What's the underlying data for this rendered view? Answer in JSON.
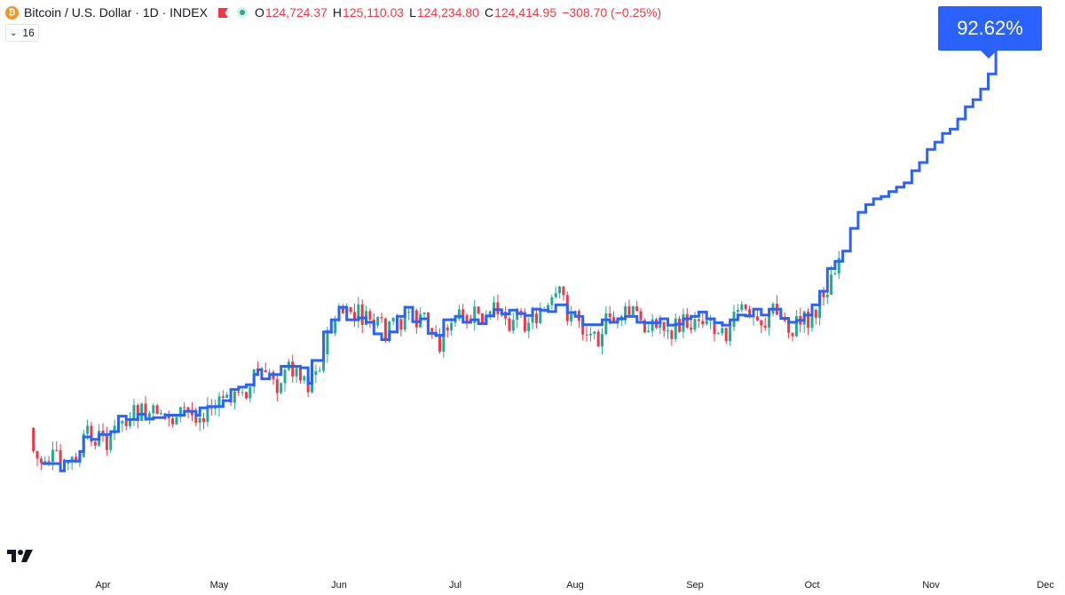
{
  "header": {
    "coin_symbol": "₿",
    "title": "Bitcoin / U.S. Dollar · 1D · INDEX",
    "open_label": "O",
    "open": "124,724.37",
    "high_label": "H",
    "high": "125,110.03",
    "low_label": "L",
    "low": "124,234.80",
    "close_label": "C",
    "close": "124,414.95",
    "change": "−308.70 (−0.25%)"
  },
  "collapse": {
    "count": "16"
  },
  "badge": {
    "value": "92.62%"
  },
  "colors": {
    "up": "#22ab94",
    "down": "#f23645",
    "line": "#2962ff",
    "text": "#131722"
  },
  "chart_data": {
    "type": "line",
    "x_ticks": [
      "Apr",
      "May",
      "Jun",
      "Jul",
      "Aug",
      "Sep",
      "Oct",
      "Nov",
      "Dec"
    ],
    "grid": false,
    "series": [
      {
        "kind": "step-line",
        "points": [
          [
            "Mar 18",
            0
          ],
          [
            "Mar 21",
            -1.5
          ],
          [
            "Mar 22",
            0.5
          ],
          [
            "Mar 26",
            2.5
          ],
          [
            "Mar 27",
            5.5
          ],
          [
            "Mar 29",
            5
          ],
          [
            "Mar 31",
            6
          ],
          [
            "Apr 3",
            6.6
          ],
          [
            "Apr 5",
            9.8
          ],
          [
            "Apr 7",
            9.1
          ],
          [
            "Apr 10",
            10.2
          ],
          [
            "Apr 12",
            9.2
          ],
          [
            "Apr 14",
            9.5
          ],
          [
            "Apr 17",
            10
          ],
          [
            "Apr 20",
            10
          ],
          [
            "Apr 22",
            10.8
          ],
          [
            "Apr 25",
            10
          ],
          [
            "Apr 26",
            11.5
          ],
          [
            "Apr 28",
            11.8
          ],
          [
            "May 2",
            13
          ],
          [
            "May 4",
            15.3
          ],
          [
            "May 6",
            15.8
          ],
          [
            "May 8",
            16.3
          ],
          [
            "May 10",
            18.4
          ],
          [
            "May 11",
            19.4
          ],
          [
            "May 12",
            17.5
          ],
          [
            "May 14",
            18.4
          ],
          [
            "May 17",
            20.1
          ],
          [
            "May 19",
            20.1
          ],
          [
            "May 22",
            19.8
          ],
          [
            "May 24",
            16.6
          ],
          [
            "May 25",
            21.3
          ],
          [
            "May 28",
            27.2
          ],
          [
            "May 30",
            29.7
          ],
          [
            "Jun 1",
            32.3
          ],
          [
            "Jun 3",
            29.7
          ],
          [
            "Jun 6",
            30.1
          ],
          [
            "Jun 8",
            29.2
          ],
          [
            "Jun 10",
            26.8
          ],
          [
            "Jun 12",
            25.6
          ],
          [
            "Jun 14",
            27.2
          ],
          [
            "Jun 16",
            30.4
          ],
          [
            "Jun 18",
            32.3
          ],
          [
            "Jun 20",
            29.3
          ],
          [
            "Jun 22",
            29.9
          ],
          [
            "Jun 24",
            26.9
          ],
          [
            "Jun 26",
            26.5
          ],
          [
            "Jun 28",
            29.7
          ],
          [
            "Jul 1",
            30.4
          ],
          [
            "Jul 3",
            29.2
          ],
          [
            "Jul 5",
            29.7
          ],
          [
            "Jul 7",
            28.9
          ],
          [
            "Jul 9",
            30.5
          ],
          [
            "Jul 11",
            31.8
          ],
          [
            "Jul 13",
            30.9
          ],
          [
            "Jul 15",
            31.7
          ],
          [
            "Jul 17",
            31
          ],
          [
            "Jul 19",
            30.6
          ],
          [
            "Jul 21",
            31.9
          ],
          [
            "Jul 23",
            31.7
          ],
          [
            "Jul 25",
            31.4
          ],
          [
            "Jul 27",
            32.8
          ],
          [
            "Jul 30",
            31.2
          ],
          [
            "Aug 1",
            30.4
          ],
          [
            "Aug 3",
            28.7
          ],
          [
            "Aug 5",
            28.7
          ],
          [
            "Aug 8",
            29.7
          ],
          [
            "Aug 10",
            29.2
          ],
          [
            "Aug 12",
            29.9
          ],
          [
            "Aug 14",
            30.4
          ],
          [
            "Aug 17",
            29.2
          ],
          [
            "Aug 19",
            29.1
          ],
          [
            "Aug 21",
            29.1
          ],
          [
            "Aug 23",
            29.9
          ],
          [
            "Aug 25",
            28.6
          ],
          [
            "Aug 27",
            28.8
          ],
          [
            "Aug 29",
            29.9
          ],
          [
            "Aug 31",
            30.4
          ],
          [
            "Sep 2",
            31.3
          ],
          [
            "Sep 4",
            29.9
          ],
          [
            "Sep 6",
            29.1
          ],
          [
            "Sep 8",
            28.6
          ],
          [
            "Sep 10",
            29.7
          ],
          [
            "Sep 12",
            30.7
          ],
          [
            "Sep 14",
            30.5
          ],
          [
            "Sep 16",
            31.9
          ],
          [
            "Sep 18",
            30.7
          ],
          [
            "Sep 20",
            31.9
          ],
          [
            "Sep 23",
            30
          ],
          [
            "Sep 25",
            29.2
          ],
          [
            "Sep 27",
            29.6
          ],
          [
            "Sep 29",
            30.7
          ],
          [
            "Oct 1",
            32.8
          ],
          [
            "Oct 3",
            35.6
          ],
          [
            "Oct 5",
            40.3
          ],
          [
            "Oct 7",
            41.8
          ],
          [
            "Oct 9",
            43.9
          ],
          [
            "Oct 11",
            48.6
          ],
          [
            "Oct 13",
            51.9
          ],
          [
            "Oct 15",
            53.5
          ],
          [
            "Oct 17",
            54.7
          ],
          [
            "Oct 19",
            55.2
          ],
          [
            "Oct 21",
            56.2
          ],
          [
            "Oct 23",
            57.1
          ],
          [
            "Oct 25",
            58
          ],
          [
            "Oct 27",
            60.5
          ],
          [
            "Oct 29",
            62.2
          ],
          [
            "Oct 31",
            64.9
          ],
          [
            "Nov 2",
            66.4
          ],
          [
            "Nov 4",
            68.2
          ],
          [
            "Nov 6",
            69.1
          ],
          [
            "Nov 8",
            71.2
          ],
          [
            "Nov 10",
            73.7
          ],
          [
            "Nov 12",
            75.2
          ],
          [
            "Nov 14",
            77.4
          ],
          [
            "Nov 16",
            80.5
          ],
          [
            "Nov 18",
            92.62
          ]
        ]
      }
    ]
  }
}
